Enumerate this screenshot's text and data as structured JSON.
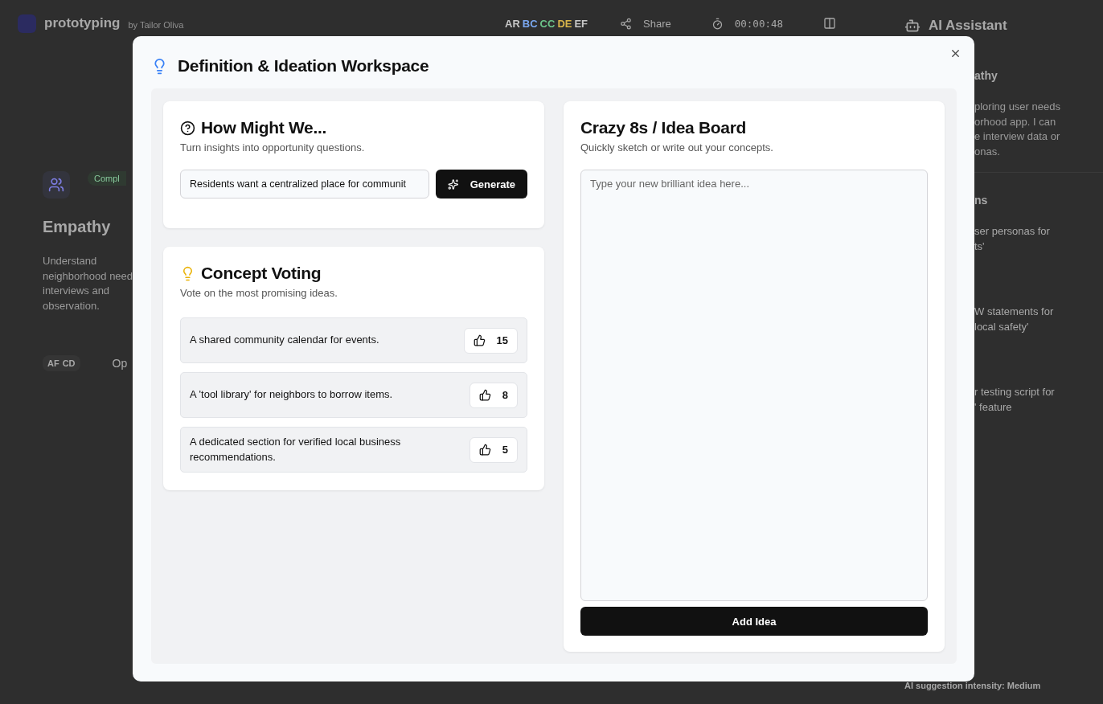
{
  "background": {
    "header": {
      "app_name": "prototyping",
      "byline": "by Tailor Oliva",
      "collaborators": [
        {
          "initials": "AR",
          "color": "#c8c8c8"
        },
        {
          "initials": "BC",
          "color": "#7aa7f0"
        },
        {
          "initials": "CC",
          "color": "#6cc48a"
        },
        {
          "initials": "DE",
          "color": "#d9b54a"
        },
        {
          "initials": "EF",
          "color": "#c8c8c8"
        }
      ],
      "share_label": "Share",
      "timer": "00:00:48"
    },
    "stage_card": {
      "status": "Compl",
      "title": "Empathy",
      "description_lines": [
        "Understand",
        "neighborhood need",
        "interviews and",
        "observation."
      ],
      "members": [
        "AF",
        "CD"
      ],
      "action": "Op"
    },
    "assistant": {
      "title": "AI Assistant",
      "stage_title": "athy",
      "message_lines": [
        "ploring user needs",
        "orhood app. I can",
        "e interview data or",
        "onas."
      ],
      "suggestions_title": "ns",
      "suggestions": [
        {
          "lines": [
            "ser personas for",
            "ts'"
          ]
        },
        {
          "lines": [
            "W statements for",
            "local safety'"
          ]
        },
        {
          "lines": [
            "r testing script for",
            "' feature"
          ]
        }
      ],
      "intensity_label": "AI suggestion intensity: Medium"
    }
  },
  "modal": {
    "title": "Definition & Ideation Workspace",
    "hmw": {
      "title": "How Might We...",
      "subtitle": "Turn insights into opportunity questions.",
      "input_value": "Residents want a centralized place for communit",
      "button": "Generate"
    },
    "voting": {
      "title": "Concept Voting",
      "subtitle": "Vote on the most promising ideas.",
      "ideas": [
        {
          "text": "A shared community calendar for events.",
          "votes": "15"
        },
        {
          "text": "A 'tool library' for neighbors to borrow items.",
          "votes": "8"
        },
        {
          "text": "A dedicated section for verified local business recommendations.",
          "votes": "5"
        }
      ]
    },
    "board": {
      "title": "Crazy 8s / Idea Board",
      "subtitle": "Quickly sketch or write out your concepts.",
      "placeholder": "Type your new brilliant idea here...",
      "button": "Add Idea"
    }
  }
}
